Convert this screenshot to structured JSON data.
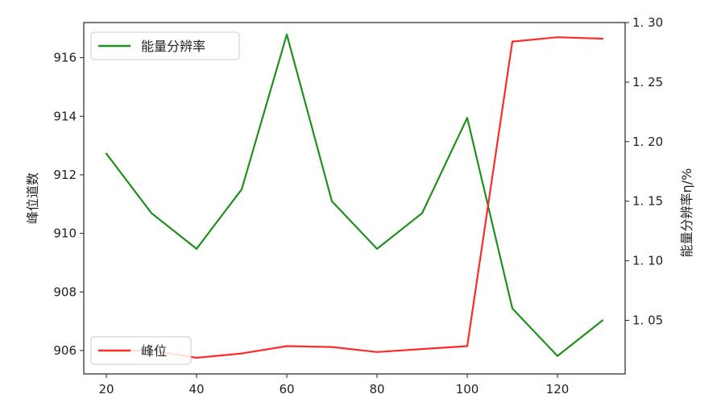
{
  "chart_data": {
    "type": "line",
    "title": "",
    "xlabel": "",
    "ylabel_left": "峰位道数",
    "ylabel_right": "能量分辨率η/%",
    "x": [
      20,
      30,
      40,
      50,
      60,
      70,
      80,
      90,
      100,
      110,
      120,
      130
    ],
    "xlim": [
      15,
      135
    ],
    "xticks": [
      "20",
      "40",
      "60",
      "80",
      "100",
      "120"
    ],
    "xtick_values": [
      20,
      40,
      60,
      80,
      100,
      120
    ],
    "ylim_left": [
      905.2,
      917.2
    ],
    "yticks_left": [
      "906",
      "908",
      "910",
      "912",
      "914",
      "916"
    ],
    "ytick_values_left": [
      906,
      908,
      910,
      912,
      914,
      916
    ],
    "ylim_right": [
      1.005,
      1.3
    ],
    "yticks_right": [
      "1. 05",
      "1. 10",
      "1. 15",
      "1. 20",
      "1. 25",
      "1. 30"
    ],
    "ytick_values_right": [
      1.05,
      1.1,
      1.15,
      1.2,
      1.25,
      1.3
    ],
    "grid": false,
    "series": [
      {
        "name": "峰位",
        "axis": "left",
        "color": "#ff2a2a",
        "values": [
          906.0,
          906.0,
          905.75,
          905.9,
          906.15,
          906.12,
          905.95,
          906.05,
          906.15,
          916.55,
          916.7,
          916.65
        ],
        "legend_position": "lower-left"
      },
      {
        "name": "能量分辨率",
        "axis": "right",
        "color": "#1f8f1f",
        "values": [
          1.19,
          1.14,
          1.11,
          1.16,
          1.29,
          1.15,
          1.11,
          1.14,
          1.22,
          1.06,
          1.02,
          1.05
        ],
        "legend_position": "upper-left"
      }
    ]
  }
}
